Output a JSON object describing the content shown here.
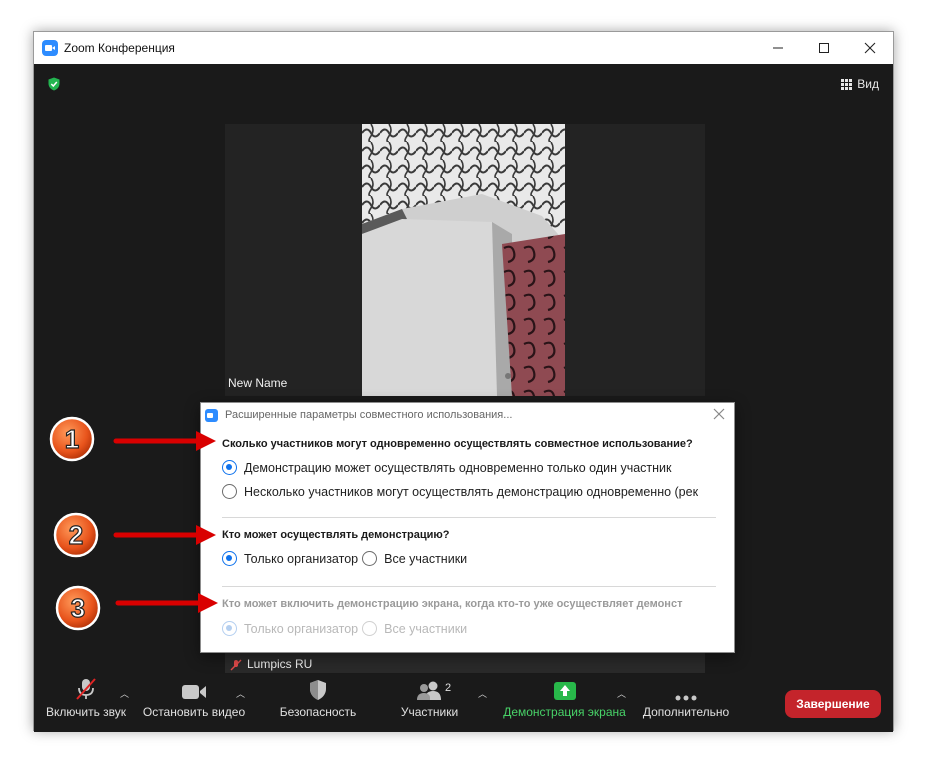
{
  "window": {
    "title": "Zoom Конференция"
  },
  "header": {
    "view_label": "Вид"
  },
  "participants": [
    {
      "name": "New Name"
    },
    {
      "name": "Lumpics RU"
    }
  ],
  "toolbar": {
    "unmute_label": "Включить звук",
    "stop_video_label": "Остановить видео",
    "security_label": "Безопасность",
    "participants_label": "Участники",
    "participants_count": "2",
    "share_label": "Демонстрация экрана",
    "more_label": "Дополнительно",
    "end_label": "Завершение"
  },
  "dialog": {
    "title": "Расширенные параметры совместного использования...",
    "q1": "Сколько участников могут одновременно осуществлять совместное использование?",
    "q1_opt1": "Демонстрацию может осуществлять одновременно только один участник",
    "q1_opt2": "Несколько участников могут осуществлять демонстрацию одновременно (рек",
    "q2": "Кто может осуществлять демонстрацию?",
    "q2_opt1": "Только организатор",
    "q2_opt2": "Все участники",
    "q3": "Кто может включить демонстрацию экрана, когда кто-то уже осуществляет демонст",
    "q3_opt1": "Только организатор",
    "q3_opt2": "Все участники"
  },
  "annotations": {
    "marker1": "1",
    "marker2": "2",
    "marker3": "3"
  },
  "colors": {
    "accent": "#0e72ed",
    "end": "#c4242b",
    "share": "#48d268",
    "marker": "#e8541c",
    "arrow": "#d90000"
  }
}
